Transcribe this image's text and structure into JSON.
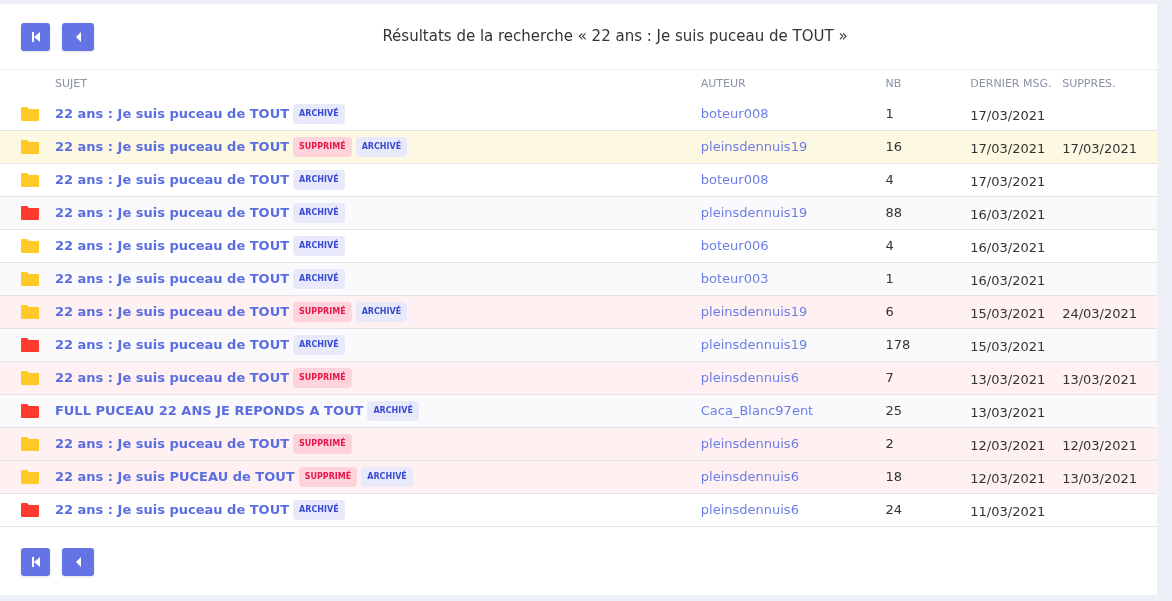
{
  "title": "Résultats de la recherche « 22 ans : Je suis puceau de TOUT »",
  "columns": [
    "SUJET",
    "AUTEUR",
    "NB",
    "DERNIER MSG.",
    "SUPPRES."
  ],
  "rows": [
    {
      "kind": "plain",
      "color": "#ffca28",
      "subject": "22 ans : Je suis puceau de TOUT",
      "tags": [
        {
          "kind": "archived",
          "label": "ARCHIVÉ"
        }
      ],
      "author": "boteur008",
      "count": "1",
      "last": "17/03/2021"
    },
    {
      "kind": "highlighted",
      "color": "#ffca28",
      "subject": "22 ans : Je suis puceau de TOUT",
      "tags": [
        {
          "kind": "deleted",
          "label": "SUPPRIMÉ"
        },
        {
          "kind": "archived",
          "label": "ARCHIVÉ"
        }
      ],
      "author": "pleinsdennuis19",
      "count": "16",
      "last": "17/03/2021",
      "deleted_on": "17/03/2021"
    },
    {
      "kind": "plain",
      "color": "#ffca28",
      "subject": "22 ans : Je suis puceau de TOUT",
      "tags": [
        {
          "kind": "archived",
          "label": "ARCHIVÉ"
        }
      ],
      "author": "boteur008",
      "count": "4",
      "last": "17/03/2021"
    },
    {
      "kind": "striped",
      "color": "#ff3b30",
      "subject": "22 ans : Je suis puceau de TOUT",
      "tags": [
        {
          "kind": "archived",
          "label": "ARCHIVÉ"
        }
      ],
      "author": "pleinsdennuis19",
      "count": "88",
      "last": "16/03/2021"
    },
    {
      "kind": "plain",
      "color": "#ffca28",
      "subject": "22 ans : Je suis puceau de TOUT",
      "tags": [
        {
          "kind": "archived",
          "label": "ARCHIVÉ"
        }
      ],
      "author": "boteur006",
      "count": "4",
      "last": "16/03/2021"
    },
    {
      "kind": "striped",
      "color": "#ffca28",
      "subject": "22 ans : Je suis puceau de TOUT",
      "tags": [
        {
          "kind": "archived",
          "label": "ARCHIVÉ"
        }
      ],
      "author": "boteur003",
      "count": "1",
      "last": "16/03/2021"
    },
    {
      "kind": "deleted",
      "color": "#ffca28",
      "subject": "22 ans : Je suis puceau de TOUT",
      "tags": [
        {
          "kind": "deleted",
          "label": "SUPPRIMÉ"
        },
        {
          "kind": "archived",
          "label": "ARCHIVÉ"
        }
      ],
      "author": "pleinsdennuis19",
      "count": "6",
      "last": "15/03/2021",
      "deleted_on": "24/03/2021"
    },
    {
      "kind": "striped",
      "color": "#ff3b30",
      "subject": "22 ans : Je suis puceau de TOUT",
      "tags": [
        {
          "kind": "archived",
          "label": "ARCHIVÉ"
        }
      ],
      "author": "pleinsdennuis19",
      "count": "178",
      "last": "15/03/2021"
    },
    {
      "kind": "deleted",
      "color": "#ffca28",
      "subject": "22 ans : Je suis puceau de TOUT",
      "tags": [
        {
          "kind": "deleted",
          "label": "SUPPRIMÉ"
        }
      ],
      "author": "pleinsdennuis6",
      "count": "7",
      "last": "13/03/2021",
      "deleted_on": "13/03/2021"
    },
    {
      "kind": "striped",
      "color": "#ff3b30",
      "subject": "FULL PUCEAU 22 ANS JE REPONDS A TOUT",
      "tags": [
        {
          "kind": "archived",
          "label": "ARCHIVÉ"
        }
      ],
      "author": "Caca_Blanc97ent",
      "count": "25",
      "last": "13/03/2021"
    },
    {
      "kind": "deleted",
      "color": "#ffca28",
      "subject": "22 ans : Je suis puceau de TOUT",
      "tags": [
        {
          "kind": "deleted",
          "label": "SUPPRIMÉ"
        }
      ],
      "author": "pleinsdennuis6",
      "count": "2",
      "last": "12/03/2021",
      "deleted_on": "12/03/2021"
    },
    {
      "kind": "deleted",
      "color": "#ffca28",
      "subject": "22 ans : Je suis PUCEAU de TOUT",
      "tags": [
        {
          "kind": "deleted",
          "label": "SUPPRIMÉ"
        },
        {
          "kind": "archived",
          "label": "ARCHIVÉ"
        }
      ],
      "author": "pleinsdennuis6",
      "count": "18",
      "last": "12/03/2021",
      "deleted_on": "13/03/2021"
    },
    {
      "kind": "plain",
      "color": "#ff3b30",
      "subject": "22 ans : Je suis puceau de TOUT",
      "tags": [
        {
          "kind": "archived",
          "label": "ARCHIVÉ"
        }
      ],
      "author": "pleinsdennuis6",
      "count": "24",
      "last": "11/03/2021"
    }
  ]
}
